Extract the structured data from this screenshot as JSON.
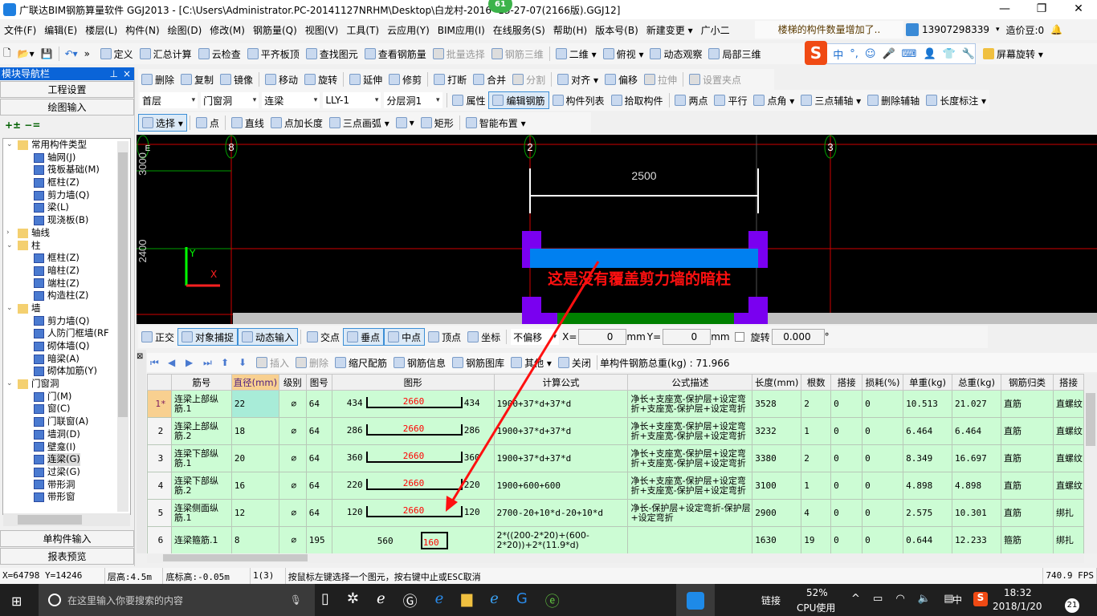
{
  "window": {
    "title": "广联达BIM钢筋算量软件 GGJ2013 - [C:\\Users\\Administrator.PC-20141127NRHM\\Desktop\\白龙村-2016     -13-27-07(2166版).GGJ12]",
    "badge": "61"
  },
  "menu": [
    "文件(F)",
    "编辑(E)",
    "楼层(L)",
    "构件(N)",
    "绘图(D)",
    "修改(M)",
    "钢筋量(Q)",
    "视图(V)",
    "工具(T)",
    "云应用(Y)",
    "BIM应用(I)",
    "在线服务(S)",
    "帮助(H)",
    "版本号(B)",
    "新建变更 ▾",
    "广小二"
  ],
  "notice": "楼梯的构件数量增加了..",
  "account": {
    "phone": "13907298339",
    "beans": "造价豆:0"
  },
  "toolbar1": [
    {
      "l": "定义"
    },
    {
      "l": "汇总计算"
    },
    {
      "l": "云检查"
    },
    {
      "l": "平齐板顶"
    },
    {
      "l": "查找图元"
    },
    {
      "l": "查看钢筋量"
    },
    {
      "l": "批量选择",
      "d": 1
    },
    {
      "l": "钢筋三维",
      "d": 1
    },
    {
      "s": 1
    },
    {
      "l": "二维 ▾"
    },
    {
      "l": "俯视 ▾"
    },
    {
      "l": "动态观察"
    },
    {
      "l": "局部三维"
    }
  ],
  "ime": [
    "中",
    "°,",
    "☺",
    "🎤",
    "⌨",
    "👤",
    "👕",
    "🔧"
  ],
  "screen_rotate": "屏幕旋转 ▾",
  "toolbar2": [
    {
      "l": "删除"
    },
    {
      "l": "复制"
    },
    {
      "l": "镜像"
    },
    {
      "s": 1
    },
    {
      "l": "移动"
    },
    {
      "l": "旋转"
    },
    {
      "s": 1
    },
    {
      "l": "延伸"
    },
    {
      "l": "修剪"
    },
    {
      "s": 1
    },
    {
      "l": "打断"
    },
    {
      "l": "合并"
    },
    {
      "l": "分割",
      "d": 1
    },
    {
      "s": 1
    },
    {
      "l": "对齐 ▾"
    },
    {
      "l": "偏移"
    },
    {
      "l": "拉伸",
      "d": 1
    },
    {
      "s": 1
    },
    {
      "l": "设置夹点",
      "d": 1
    }
  ],
  "selectors": [
    "首层",
    "门窗洞",
    "连梁",
    "LLY-1",
    "分层洞1"
  ],
  "toolbar3": [
    {
      "l": "属性"
    },
    {
      "l": "编辑钢筋",
      "a": 1
    },
    {
      "l": "构件列表"
    },
    {
      "l": "拾取构件"
    },
    {
      "s": 1
    },
    {
      "l": "两点"
    },
    {
      "l": "平行"
    },
    {
      "l": "点角 ▾"
    },
    {
      "l": "三点辅轴 ▾"
    },
    {
      "l": "删除辅轴"
    },
    {
      "l": "长度标注 ▾"
    }
  ],
  "toolbar4": [
    {
      "l": "选择 ▾",
      "a": 1
    },
    {
      "s": 1
    },
    {
      "l": "点"
    },
    {
      "s": 1
    },
    {
      "l": "直线"
    },
    {
      "l": "点加长度"
    },
    {
      "l": "三点画弧 ▾"
    },
    {
      "l": "      ▾"
    },
    {
      "l": "矩形"
    },
    {
      "s": 1
    },
    {
      "l": "智能布置 ▾"
    }
  ],
  "nav": {
    "title": "模块导航栏",
    "buttons": [
      "工程设置",
      "绘图输入"
    ],
    "bottom": [
      "单构件输入",
      "报表预览"
    ],
    "tree": [
      {
        "l": "常用构件类型",
        "lv": 0,
        "f": 1
      },
      {
        "l": "轴网(J)",
        "lv": 1
      },
      {
        "l": "筏板基础(M)",
        "lv": 1
      },
      {
        "l": "框柱(Z)",
        "lv": 1
      },
      {
        "l": "剪力墙(Q)",
        "lv": 1
      },
      {
        "l": "梁(L)",
        "lv": 1
      },
      {
        "l": "现浇板(B)",
        "lv": 1
      },
      {
        "l": "轴线",
        "lv": 0,
        "f": 1,
        "c": 1
      },
      {
        "l": "柱",
        "lv": 0,
        "f": 1
      },
      {
        "l": "框柱(Z)",
        "lv": 1
      },
      {
        "l": "暗柱(Z)",
        "lv": 1
      },
      {
        "l": "端柱(Z)",
        "lv": 1
      },
      {
        "l": "构造柱(Z)",
        "lv": 1
      },
      {
        "l": "墙",
        "lv": 0,
        "f": 1
      },
      {
        "l": "剪力墙(Q)",
        "lv": 1
      },
      {
        "l": "人防门框墙(RF",
        "lv": 1
      },
      {
        "l": "砌体墙(Q)",
        "lv": 1
      },
      {
        "l": "暗梁(A)",
        "lv": 1
      },
      {
        "l": "砌体加筋(Y)",
        "lv": 1
      },
      {
        "l": "门窗洞",
        "lv": 0,
        "f": 1
      },
      {
        "l": "门(M)",
        "lv": 1
      },
      {
        "l": "窗(C)",
        "lv": 1
      },
      {
        "l": "门联窗(A)",
        "lv": 1
      },
      {
        "l": "墙洞(D)",
        "lv": 1
      },
      {
        "l": "壁龛(I)",
        "lv": 1
      },
      {
        "l": "连梁(G)",
        "lv": 1,
        "sel": 1
      },
      {
        "l": "过梁(G)",
        "lv": 1
      },
      {
        "l": "带形洞",
        "lv": 1
      },
      {
        "l": "带形窗",
        "lv": 1
      }
    ]
  },
  "canvas": {
    "axes": [
      "8",
      "2",
      "3",
      "E"
    ],
    "dim": "2500",
    "side_dims": [
      "3000",
      "2400"
    ],
    "annotation": "这是没有覆盖剪力墙的暗柱",
    "x_label": "X",
    "y_label": "Y"
  },
  "snapbar": {
    "items": [
      {
        "l": "正交"
      },
      {
        "l": "对象捕捉",
        "a": 1
      },
      {
        "l": "动态输入",
        "a": 1
      },
      {
        "s": 1
      },
      {
        "l": "交点"
      },
      {
        "l": "垂点",
        "a": 1
      },
      {
        "l": "中点",
        "a": 1
      },
      {
        "l": "顶点"
      },
      {
        "l": "坐标"
      }
    ],
    "offset": "不偏移",
    "x_label": "X=",
    "x": "0",
    "y_label": "Y=",
    "y": "0",
    "unit": "mm",
    "rotate_label": "旋转",
    "rotate": "0.000",
    "deg": "°"
  },
  "rebarbar": {
    "items": [
      {
        "l": "插入",
        "d": 1
      },
      {
        "l": "删除",
        "d": 1
      },
      {
        "l": "缩尺配筋"
      },
      {
        "l": "钢筋信息"
      },
      {
        "l": "钢筋图库"
      },
      {
        "l": "其他 ▾"
      },
      {
        "l": "关闭"
      }
    ],
    "total": "单构件钢筋总重(kg) : 71.966"
  },
  "table": {
    "headers": [
      "",
      "筋号",
      "直径(mm)",
      "级别",
      "图号",
      "图形",
      "计算公式",
      "公式描述",
      "长度(mm)",
      "根数",
      "搭接",
      "损耗(%)",
      "单重(kg)",
      "总重(kg)",
      "钢筋归类",
      "搭接"
    ],
    "rows": [
      [
        "1*",
        "连梁上部纵筋.1",
        "22",
        "⌀",
        "64",
        [
          "434",
          "2660",
          "434"
        ],
        "1900+37*d+37*d",
        "净长+支座宽-保护层+设定弯折+支座宽-保护层+设定弯折",
        "3528",
        "2",
        "0",
        "0",
        "10.513",
        "21.027",
        "直筋",
        "直螺纹"
      ],
      [
        "2",
        "连梁上部纵筋.2",
        "18",
        "⌀",
        "64",
        [
          "286",
          "2660",
          "286"
        ],
        "1900+37*d+37*d",
        "净长+支座宽-保护层+设定弯折+支座宽-保护层+设定弯折",
        "3232",
        "1",
        "0",
        "0",
        "6.464",
        "6.464",
        "直筋",
        "直螺纹"
      ],
      [
        "3",
        "连梁下部纵筋.1",
        "20",
        "⌀",
        "64",
        [
          "360",
          "2660",
          "360"
        ],
        "1900+37*d+37*d",
        "净长+支座宽-保护层+设定弯折+支座宽-保护层+设定弯折",
        "3380",
        "2",
        "0",
        "0",
        "8.349",
        "16.697",
        "直筋",
        "直螺纹"
      ],
      [
        "4",
        "连梁下部纵筋.2",
        "16",
        "⌀",
        "64",
        [
          "220",
          "2660",
          "220"
        ],
        "1900+600+600",
        "净长+支座宽-保护层+设定弯折+支座宽-保护层+设定弯折",
        "3100",
        "1",
        "0",
        "0",
        "4.898",
        "4.898",
        "直筋",
        "直螺纹"
      ],
      [
        "5",
        "连梁侧面纵筋.1",
        "12",
        "⌀",
        "64",
        [
          "120",
          "2660",
          "120"
        ],
        "2700-20+10*d-20+10*d",
        "净长-保护层+设定弯折-保护层+设定弯折",
        "2900",
        "4",
        "0",
        "0",
        "2.575",
        "10.301",
        "直筋",
        "绑扎"
      ],
      [
        "6",
        "连梁箍筋.1",
        "8",
        "⌀",
        "195",
        [
          "560",
          "160"
        ],
        "2*((200-2*20)+(600-2*20))+2*(11.9*d)",
        "",
        "1630",
        "19",
        "0",
        "0",
        "0.644",
        "12.233",
        "箍筋",
        "绑扎"
      ]
    ]
  },
  "status": [
    "X=64798 Y=14246",
    "层高:4.5m",
    "底标高:-0.05m",
    "1(3)",
    "按鼠标左键选择一个图元，按右键中止或ESC取消",
    "740.9 FPS"
  ],
  "taskbar": {
    "search": "在这里输入你要搜索的内容",
    "link": "链接",
    "cpu": "52%",
    "cpu_label": "CPU使用",
    "ime": "中",
    "time": "18:32",
    "date": "2018/1/20",
    "notif": "21"
  },
  "colors": {
    "accent": "#0a64d8",
    "grid_row": "#ccfcd4",
    "axis": "#d00000",
    "column": "#7a00f0",
    "beam": "#0080f0",
    "wall": "#008000"
  }
}
